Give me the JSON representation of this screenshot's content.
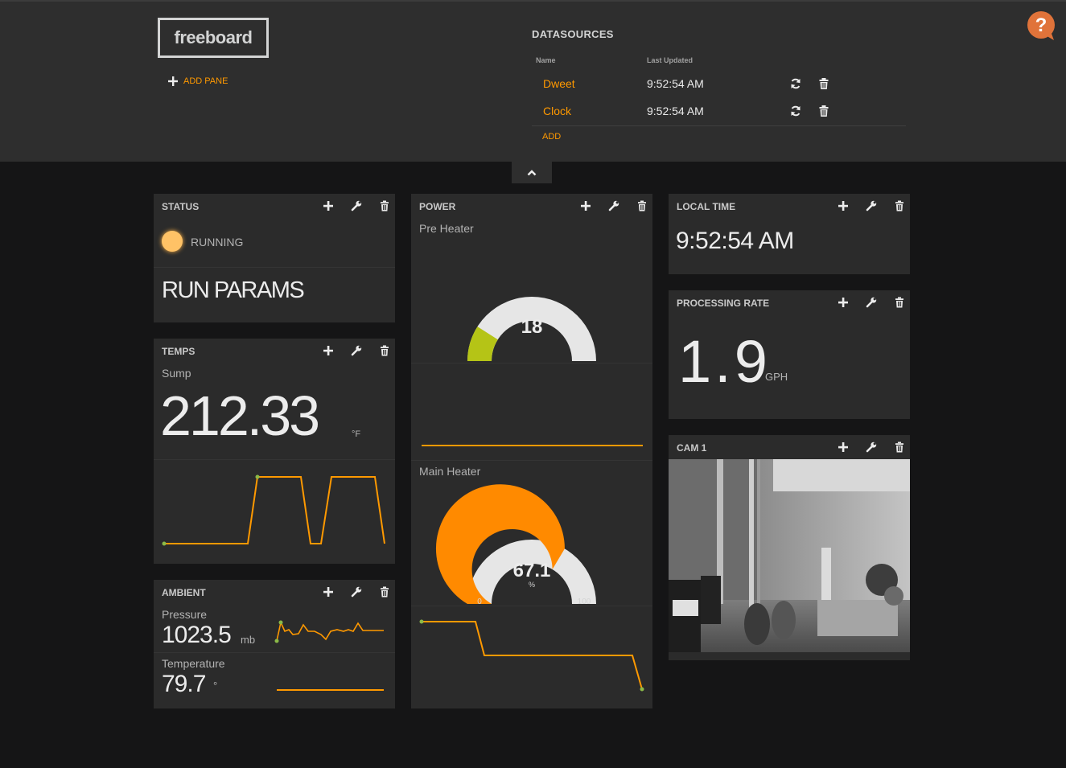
{
  "header": {
    "logo": "freeboard",
    "add_pane": "ADD PANE",
    "datasources_title": "DATASOURCES",
    "col_name": "Name",
    "col_updated": "Last Updated",
    "datasources": [
      {
        "name": "Dweet",
        "updated": "9:52:54 AM"
      },
      {
        "name": "Clock",
        "updated": "9:52:54 AM"
      }
    ],
    "add": "ADD"
  },
  "panes": {
    "status": {
      "title": "STATUS",
      "indicator_label": "RUNNING",
      "indicator_color": "#ffc266",
      "text": "RUN PARAMS"
    },
    "temps": {
      "title": "TEMPS",
      "label": "Sump",
      "value": "212.33",
      "units": "°F"
    },
    "ambient": {
      "title": "AMBIENT",
      "pressure_label": "Pressure",
      "pressure_value": "1023.5",
      "pressure_units": "mb",
      "temperature_label": "Temperature",
      "temperature_value": "79.7",
      "temperature_units": "°"
    },
    "power": {
      "title": "POWER",
      "pre_heater": {
        "label": "Pre Heater",
        "value": "18",
        "min": "0",
        "max": "100",
        "fraction": 0.18,
        "color": "#b5c416"
      },
      "main_heater": {
        "label": "Main Heater",
        "value": "67.1",
        "units": "%",
        "min": "0",
        "max": "100",
        "fraction": 0.671,
        "color": "#ff8a00"
      }
    },
    "local_time": {
      "title": "LOCAL TIME",
      "value": "9:52:54 AM"
    },
    "processing_rate": {
      "title": "PROCESSING RATE",
      "value": "1.9",
      "units": "GPH"
    },
    "cam": {
      "title": "CAM 1"
    }
  },
  "colors": {
    "accent": "#ff9900",
    "sparkline": "#ff9900",
    "spark_dot": "#8bba48"
  }
}
